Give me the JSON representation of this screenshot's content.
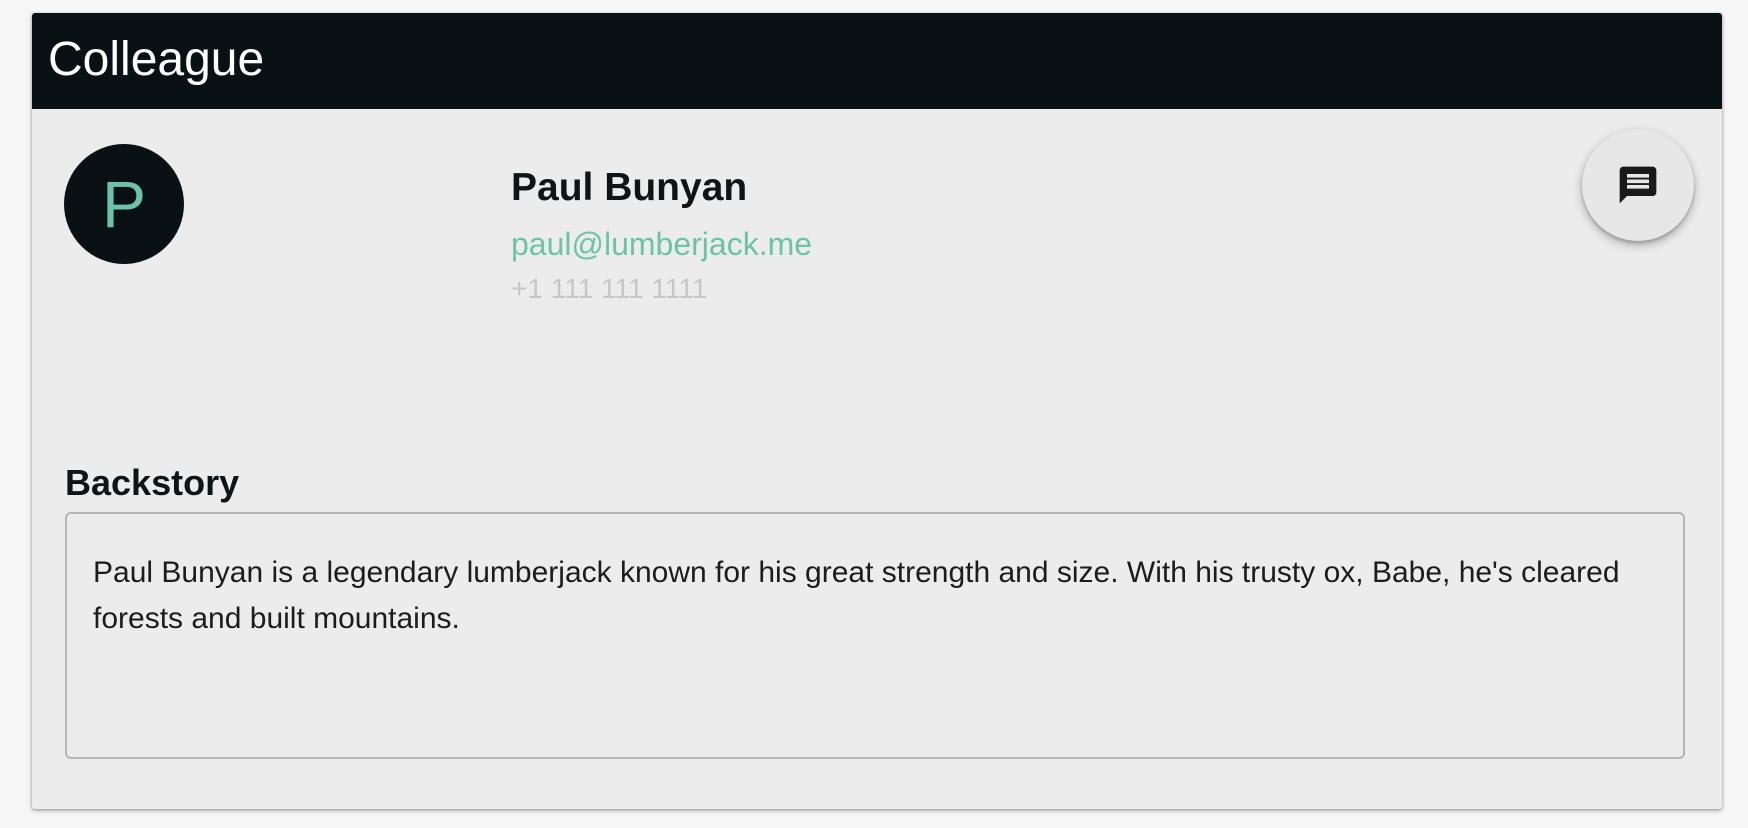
{
  "card": {
    "title": "Colleague"
  },
  "profile": {
    "avatar_letter": "P",
    "name": "Paul Bunyan",
    "email": "paul@lumberjack.me",
    "phone": "+1 111 111 1111"
  },
  "actions": {
    "message_icon": "chat-bubble-icon"
  },
  "backstory": {
    "heading": "Backstory",
    "text": "Paul Bunyan is a legendary lumberjack known for his great strength and size. With his trusty ox, Babe, he's cleared forests and built mountains."
  },
  "colors": {
    "header_bg": "#0a1114",
    "accent": "#6cc4a8",
    "card_bg": "#ececec"
  }
}
